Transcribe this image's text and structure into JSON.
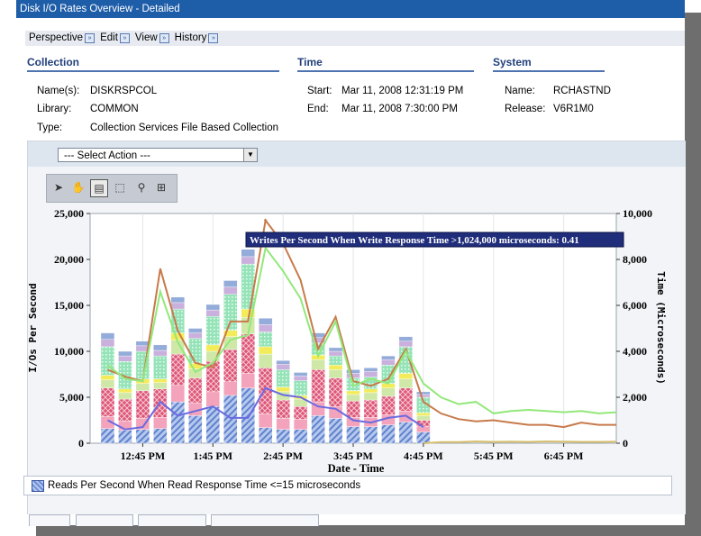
{
  "window": {
    "title": "Disk I/O Rates Overview - Detailed"
  },
  "menu": [
    "Perspective",
    "Edit",
    "View",
    "History"
  ],
  "collection": {
    "heading": "Collection",
    "name_label": "Name(s):",
    "name": "DISKRSPCOL",
    "library_label": "Library:",
    "library": "COMMON",
    "type_label": "Type:",
    "type": "Collection Services File Based Collection"
  },
  "time": {
    "heading": "Time",
    "start_label": "Start:",
    "start": "Mar 11, 2008 12:31:19 PM",
    "end_label": "End:",
    "end": "Mar 11, 2008 7:30:00 PM"
  },
  "system": {
    "heading": "System",
    "name_label": "Name:",
    "name": "RCHASTND",
    "release_label": "Release:",
    "release": "V6R1M0"
  },
  "action_select": {
    "value": "--- Select Action ---"
  },
  "toolbar_icons": [
    "select-arrow-icon",
    "pan-hand-icon",
    "tooltip-icon",
    "zoom-box-icon",
    "zoom-out-icon",
    "fit-all-icon"
  ],
  "legend": {
    "label": "Reads Per Second When Read Response Time <=15 microseconds"
  },
  "chart_data": {
    "type": "bar",
    "xlabel": "Date - Time",
    "ylabel": "I/Os Per Second",
    "y2label": "Time (Microseconds)",
    "ylim": [
      0,
      25000
    ],
    "y2lim": [
      0,
      10000
    ],
    "yticks": [
      "0",
      "5,000",
      "10,000",
      "15,000",
      "20,000",
      "25,000"
    ],
    "y2ticks": [
      "0",
      "2,000",
      "4,000",
      "6,000",
      "8,000",
      "10,000"
    ],
    "xticks": [
      "12:45 PM",
      "1:45 PM",
      "2:45 PM",
      "3:45 PM",
      "4:45 PM",
      "5:45 PM",
      "6:45 PM"
    ],
    "x_start_minutes": 720,
    "x_end_minutes": 1170,
    "bar_times_minutes": [
      735,
      750,
      765,
      780,
      795,
      810,
      825,
      840,
      855,
      870,
      885,
      900,
      915,
      930,
      945,
      960,
      975,
      990,
      1005
    ],
    "stacks": [
      {
        "color": "#7f9fd8",
        "pattern": "diag",
        "values": [
          1600,
          1400,
          1500,
          1600,
          4500,
          3000,
          4000,
          5200,
          6000,
          1700,
          1500,
          1500,
          3000,
          2700,
          1800,
          1800,
          2000,
          2300,
          1200
        ]
      },
      {
        "color": "#f3a3bb",
        "pattern": "plain",
        "values": [
          1300,
          1000,
          1200,
          1200,
          1800,
          1400,
          1600,
          1500,
          1600,
          1500,
          1200,
          1100,
          1500,
          1300,
          1000,
          1000,
          1100,
          1200,
          600
        ]
      },
      {
        "color": "#dc5476",
        "pattern": "cross",
        "values": [
          3100,
          2400,
          3000,
          3100,
          3400,
          2700,
          3300,
          3500,
          4300,
          5000,
          2000,
          1400,
          3500,
          3100,
          1800,
          1900,
          2000,
          2500,
          700
        ]
      },
      {
        "color": "#cfe8a8",
        "pattern": "plain",
        "values": [
          900,
          700,
          800,
          700,
          1500,
          1000,
          1100,
          1400,
          1800,
          1500,
          900,
          800,
          1100,
          900,
          700,
          800,
          900,
          1000,
          500
        ]
      },
      {
        "color": "#f3ec5a",
        "pattern": "plain",
        "values": [
          500,
          400,
          500,
          400,
          800,
          600,
          700,
          700,
          900,
          800,
          500,
          400,
          500,
          500,
          400,
          400,
          500,
          600,
          300
        ]
      },
      {
        "color": "#97e3b9",
        "pattern": "dots",
        "values": [
          3100,
          3000,
          3000,
          2500,
          2600,
          2700,
          3100,
          3900,
          4900,
          1600,
          1900,
          1600,
          1300,
          1000,
          1400,
          1300,
          2000,
          2900,
          1700
        ]
      },
      {
        "color": "#c9b0dd",
        "pattern": "plain",
        "values": [
          800,
          600,
          600,
          600,
          700,
          600,
          700,
          800,
          800,
          800,
          600,
          500,
          600,
          500,
          500,
          600,
          600,
          600,
          300
        ]
      },
      {
        "color": "#94acd9",
        "pattern": "plain",
        "values": [
          700,
          500,
          500,
          600,
          600,
          500,
          600,
          700,
          800,
          700,
          400,
          400,
          500,
          400,
          400,
          400,
          400,
          500,
          300
        ]
      }
    ],
    "lines": [
      {
        "color": "#c77a4a",
        "x": [
          735,
          750,
          765,
          780,
          795,
          810,
          825,
          840,
          855,
          870,
          885,
          900,
          915,
          930,
          945,
          960,
          975,
          990,
          1005,
          1020,
          1035,
          1050,
          1065,
          1080,
          1095,
          1110,
          1125,
          1140,
          1155,
          1170
        ],
        "values": [
          3200,
          2900,
          2700,
          7600,
          4900,
          3500,
          3300,
          5300,
          5300,
          9700,
          8700,
          7100,
          4100,
          5500,
          2700,
          2500,
          2800,
          4100,
          1800,
          1300,
          1050,
          950,
          1000,
          900,
          800,
          800,
          700,
          900,
          800,
          800
        ]
      },
      {
        "color": "#92e87a",
        "x": [
          735,
          750,
          765,
          780,
          795,
          810,
          825,
          840,
          855,
          870,
          885,
          900,
          915,
          930,
          945,
          960,
          975,
          990,
          1005,
          1020,
          1035,
          1050,
          1065,
          1080,
          1095,
          1110,
          1125,
          1140,
          1155,
          1170
        ],
        "values": [
          3400,
          2800,
          2700,
          6600,
          4400,
          3100,
          3500,
          4500,
          4700,
          8500,
          7500,
          6300,
          3800,
          5300,
          2500,
          2800,
          2600,
          4000,
          2600,
          2000,
          1700,
          1800,
          1300,
          1400,
          1450,
          1400,
          1350,
          1400,
          1300,
          1350
        ]
      },
      {
        "color": "#6a6ae0",
        "x": [
          735,
          750,
          765,
          780,
          795,
          810,
          825,
          840,
          855,
          870,
          885,
          900,
          915,
          930,
          945,
          960,
          975,
          990,
          1005
        ],
        "values": [
          1000,
          600,
          700,
          1800,
          1200,
          1400,
          1600,
          1100,
          1100,
          2400,
          2100,
          2000,
          1600,
          1500,
          1000,
          900,
          1100,
          1200,
          700
        ]
      },
      {
        "color": "#d8c070",
        "x": [
          1005,
          1020,
          1035,
          1050,
          1065,
          1080,
          1095,
          1110,
          1125,
          1140,
          1155,
          1170
        ],
        "values": [
          0,
          50,
          50,
          80,
          60,
          70,
          60,
          80,
          70,
          60,
          60,
          70
        ]
      }
    ],
    "annotation": "Writes Per Second When Write Response Time >1,024,000 microseconds: 0.41",
    "annotation_at": {
      "x": 870,
      "y2": 9700
    }
  }
}
